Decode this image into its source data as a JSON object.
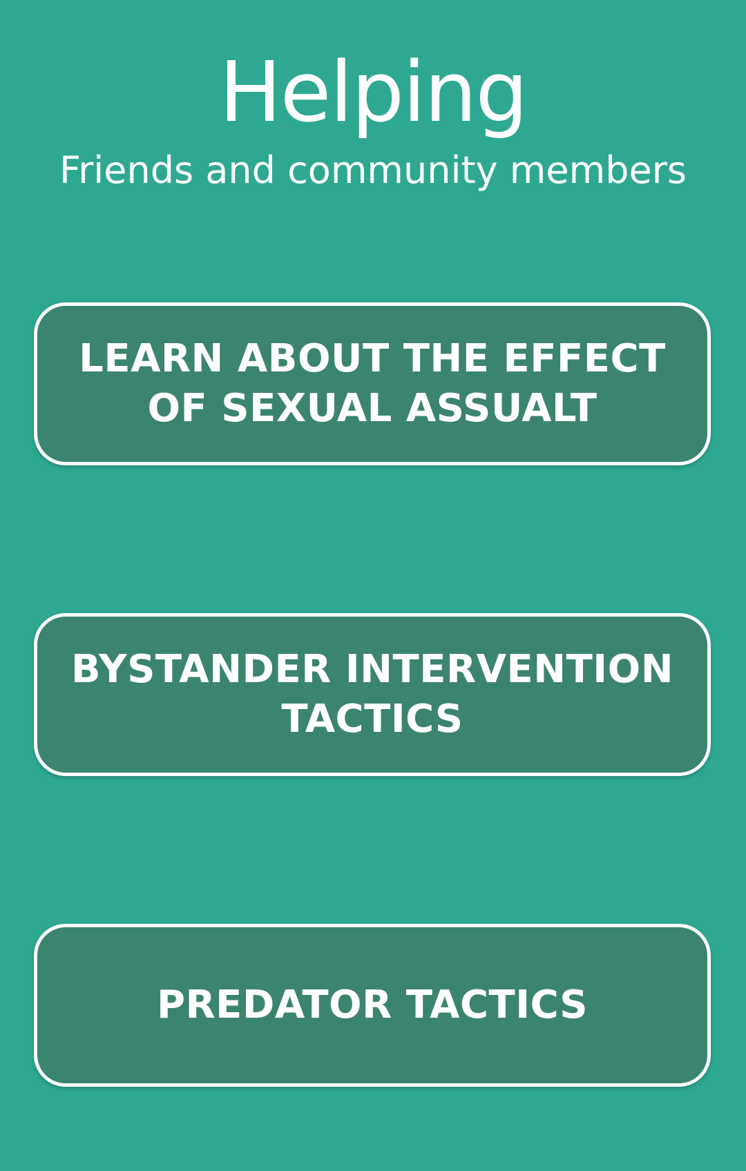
{
  "header": {
    "title": "Helping",
    "subtitle": "Friends and community members"
  },
  "menu": {
    "items": [
      {
        "label": "LEARN ABOUT THE EFFECT OF SEXUAL ASSUALT"
      },
      {
        "label": "BYSTANDER INTERVENTION TACTICS"
      },
      {
        "label": "PREDATOR TACTICS"
      }
    ]
  },
  "colors": {
    "background": "#2ea891",
    "button_fill": "#3b8470",
    "button_border": "#ffffff",
    "text": "#ffffff"
  }
}
